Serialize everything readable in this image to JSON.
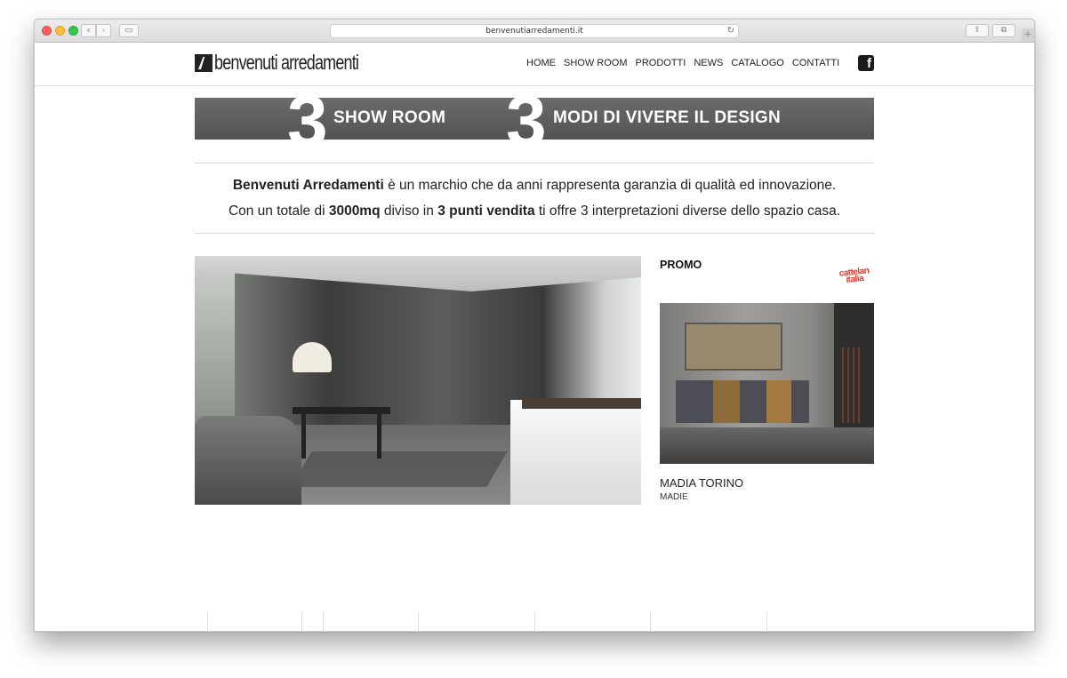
{
  "browser": {
    "url": "benvenutiarredamenti.it",
    "back_glyph": "‹",
    "forward_glyph": "›",
    "sidebar_glyph": "▭",
    "reload_glyph": "↻",
    "share_glyph": "⇧",
    "tabs_glyph": "⧉",
    "newtab_glyph": "+"
  },
  "header": {
    "logo_text": "benvenuti arredamenti",
    "nav": [
      "HOME",
      "SHOW ROOM",
      "PRODOTTI",
      "NEWS",
      "CATALOGO",
      "CONTATTI"
    ],
    "social_glyph": "f"
  },
  "banner": {
    "num1": "3",
    "text1": "SHOW ROOM",
    "num2": "3",
    "text2": "MODI DI VIVERE IL DESIGN"
  },
  "intro": {
    "line1_bold": "Benvenuti Arredamenti",
    "line1_rest": " è un marchio che da anni rappresenta garanzia di qualità ed innovazione.",
    "line2_a": "Con un totale di ",
    "line2_bold1": "3000mq",
    "line2_b": " diviso in ",
    "line2_bold2": "3 punti vendita",
    "line2_c": " ti offre 3 interpretazioni diverse dello spazio casa."
  },
  "promo": {
    "title": "PROMO",
    "brand": "cattelan italia",
    "product_name": "MADIA TORINO",
    "product_category": "MADIE"
  },
  "colors": {
    "banner_bg": "#5f5e60",
    "brand_red": "#e4332b",
    "text": "#222222"
  }
}
